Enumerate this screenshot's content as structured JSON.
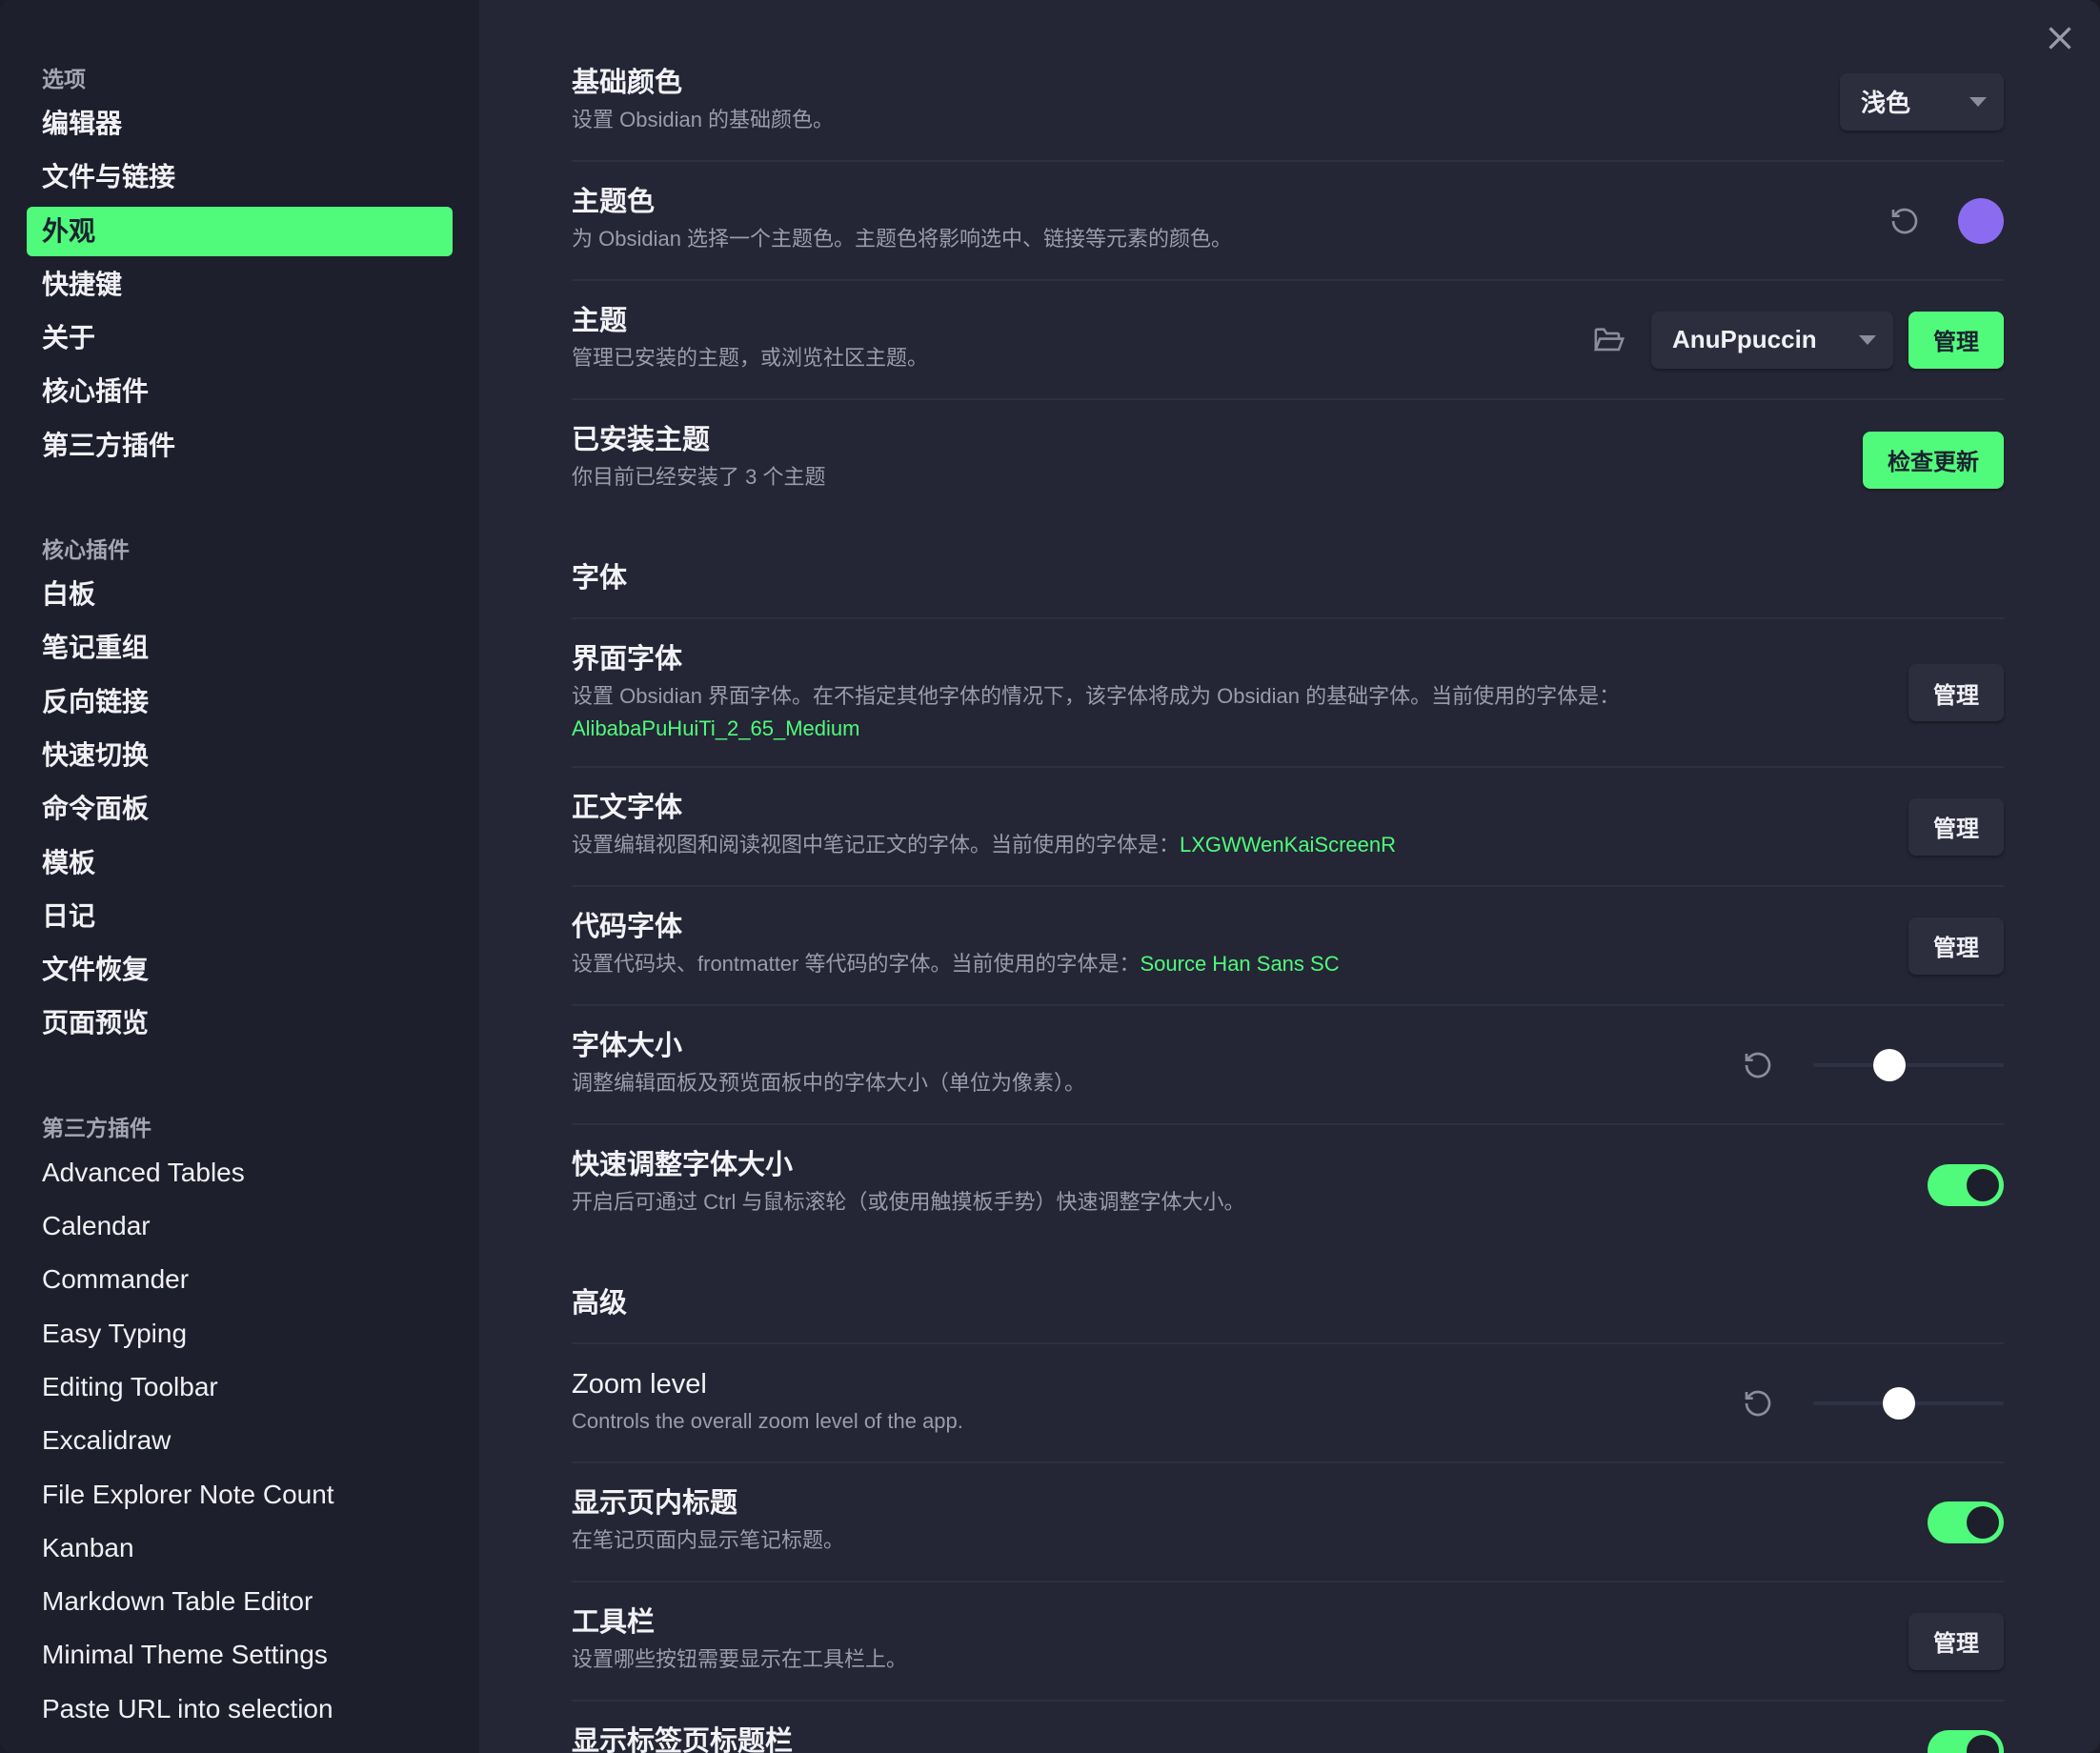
{
  "sidebar": {
    "sections": [
      {
        "heading": "选项",
        "items": [
          "编辑器",
          "文件与链接",
          "外观",
          "快捷键",
          "关于",
          "核心插件",
          "第三方插件"
        ],
        "active": "外观"
      },
      {
        "heading": "核心插件",
        "items": [
          "白板",
          "笔记重组",
          "反向链接",
          "快速切换",
          "命令面板",
          "模板",
          "日记",
          "文件恢复",
          "页面预览"
        ]
      },
      {
        "heading": "第三方插件",
        "items": [
          "Advanced Tables",
          "Calendar",
          "Commander",
          "Easy Typing",
          "Editing Toolbar",
          "Excalidraw",
          "File Explorer Note Count",
          "Kanban",
          "Markdown Table Editor",
          "Minimal Theme Settings",
          "Paste URL into selection"
        ]
      }
    ]
  },
  "settings": {
    "base_color": {
      "title": "基础颜色",
      "desc": "设置 Obsidian 的基础颜色。",
      "value": "浅色"
    },
    "accent_color": {
      "title": "主题色",
      "desc": "为 Obsidian 选择一个主题色。主题色将影响选中、链接等元素的颜色。",
      "color": "#8b6cf0"
    },
    "theme": {
      "title": "主题",
      "desc": "管理已安装的主题，或浏览社区主题。",
      "value": "AnuPpuccin",
      "manage": "管理"
    },
    "installed": {
      "title": "已安装主题",
      "desc": "你目前已经安装了 3 个主题",
      "button": "检查更新"
    },
    "font_heading": "字体",
    "ui_font": {
      "title": "界面字体",
      "desc": "设置 Obsidian 界面字体。在不指定其他字体的情况下，该字体将成为 Obsidian 的基础字体。当前使用的字体是：",
      "current": "AlibabaPuHuiTi_2_65_Medium",
      "manage": "管理"
    },
    "text_font": {
      "title": "正文字体",
      "desc": "设置编辑视图和阅读视图中笔记正文的字体。当前使用的字体是：",
      "current": "LXGWWenKaiScreenR",
      "manage": "管理"
    },
    "mono_font": {
      "title": "代码字体",
      "desc": "设置代码块、frontmatter 等代码的字体。当前使用的字体是：",
      "current": "Source Han Sans SC",
      "manage": "管理"
    },
    "font_size": {
      "title": "字体大小",
      "desc": "调整编辑面板及预览面板中的字体大小（单位为像素）。",
      "fraction": 0.4
    },
    "quick_font": {
      "title": "快速调整字体大小",
      "desc": "开启后可通过 Ctrl 与鼠标滚轮（或使用触摸板手势）快速调整字体大小。",
      "enabled": true
    },
    "advanced_heading": "高级",
    "zoom": {
      "title": "Zoom level",
      "desc": "Controls the overall zoom level of the app.",
      "fraction": 0.45
    },
    "inline_title": {
      "title": "显示页内标题",
      "desc": "在笔记页面内显示笔记标题。",
      "enabled": true
    },
    "toolbar": {
      "title": "工具栏",
      "desc": "设置哪些按钮需要显示在工具栏上。",
      "manage": "管理"
    },
    "tab_title_bar": {
      "title": "显示标签页标题栏"
    }
  }
}
